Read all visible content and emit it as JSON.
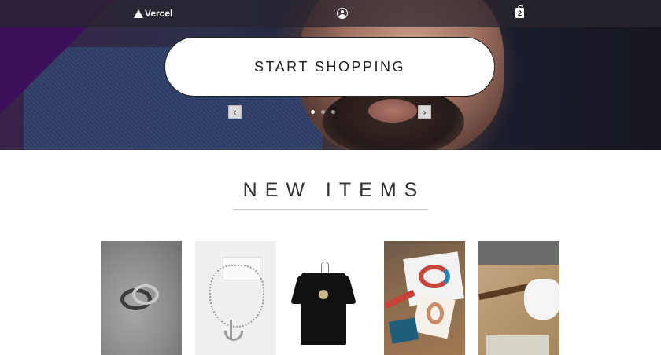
{
  "header": {
    "logo_text": "Vercel",
    "cart_count": "2"
  },
  "hero": {
    "cta_label": "START SHOPPING",
    "prev_label": "‹",
    "next_label": "›",
    "slides": 3,
    "active_slide": 1
  },
  "new_items": {
    "title": "NEW ITEMS",
    "products": [
      {
        "icon": "ring-photo"
      },
      {
        "icon": "necklace-photo"
      },
      {
        "icon": "tshirt-photo"
      },
      {
        "icon": "prints-photo"
      },
      {
        "icon": "guitar-photo"
      }
    ]
  }
}
